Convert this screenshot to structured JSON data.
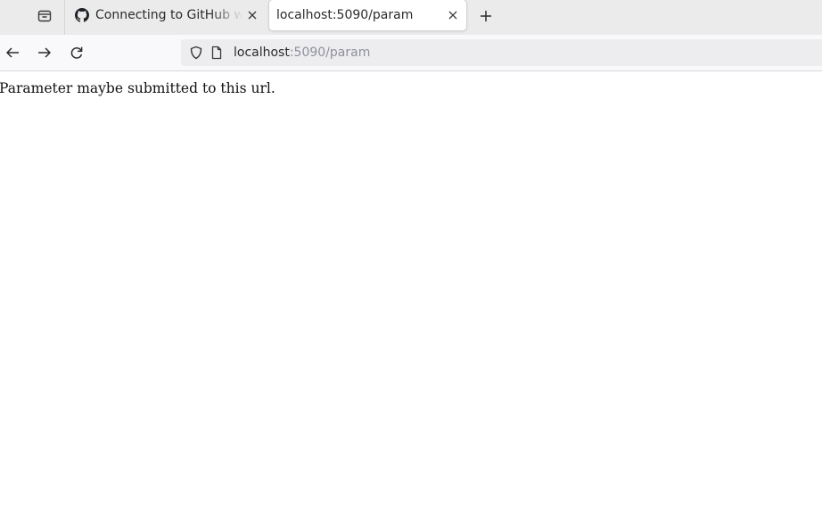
{
  "tabs": [
    {
      "title": "Connecting to GitHub with SSH",
      "icon": "github-icon",
      "active": false
    },
    {
      "title": "localhost:5090/param",
      "icon": "",
      "active": true
    }
  ],
  "urlbar": {
    "host": "localhost",
    "path": ":5090/param"
  },
  "page": {
    "body_text": "Parameter maybe submitted to this url."
  },
  "icons": {
    "tab_list": "tab-list-icon",
    "close": "close-icon",
    "new_tab": "plus-icon",
    "back": "back-arrow-icon",
    "forward": "forward-arrow-icon",
    "reload": "reload-icon",
    "tracking_protection": "shield-icon",
    "page_info": "page-icon"
  },
  "colors": {
    "tab_strip": "#ebebeb",
    "active_tab": "#ffffff",
    "url_bar": "#ededf0",
    "url_path": "#8f8f9d"
  }
}
